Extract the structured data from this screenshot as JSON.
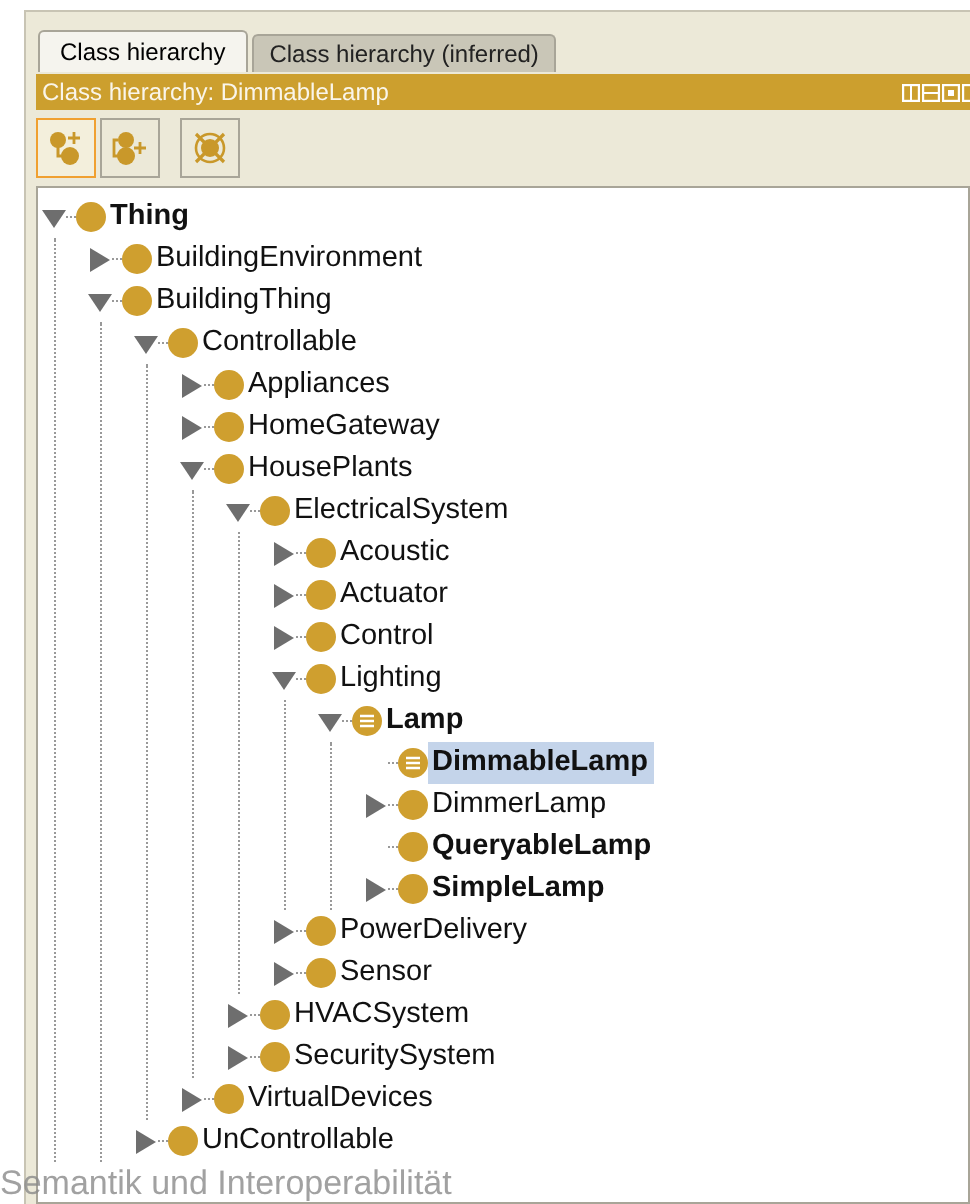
{
  "tabs": [
    {
      "label": "Class hierarchy",
      "selected": true
    },
    {
      "label": "Class hierarchy (inferred)",
      "selected": false
    }
  ],
  "view_title": "Class hierarchy: DimmableLamp",
  "toolbar": [
    {
      "kind": "add-subclass",
      "active": true
    },
    {
      "kind": "add-sibling",
      "active": false
    },
    {
      "kind": "delete",
      "active": false
    }
  ],
  "tree": [
    {
      "label": "Thing",
      "expanded": true,
      "bold": true,
      "kind": "primitive",
      "selected": false,
      "children": [
        {
          "label": "BuildingEnvironment",
          "expanded": false,
          "bold": false,
          "kind": "primitive",
          "selected": false
        },
        {
          "label": "BuildingThing",
          "expanded": true,
          "bold": false,
          "kind": "primitive",
          "selected": false,
          "children": [
            {
              "label": "Controllable",
              "expanded": true,
              "bold": false,
              "kind": "primitive",
              "selected": false,
              "children": [
                {
                  "label": "Appliances",
                  "expanded": false,
                  "bold": false,
                  "kind": "primitive",
                  "selected": false
                },
                {
                  "label": "HomeGateway",
                  "expanded": false,
                  "bold": false,
                  "kind": "primitive",
                  "selected": false
                },
                {
                  "label": "HousePlants",
                  "expanded": true,
                  "bold": false,
                  "kind": "primitive",
                  "selected": false,
                  "children": [
                    {
                      "label": "ElectricalSystem",
                      "expanded": true,
                      "bold": false,
                      "kind": "primitive",
                      "selected": false,
                      "children": [
                        {
                          "label": "Acoustic",
                          "expanded": false,
                          "bold": false,
                          "kind": "primitive",
                          "selected": false
                        },
                        {
                          "label": "Actuator",
                          "expanded": false,
                          "bold": false,
                          "kind": "primitive",
                          "selected": false
                        },
                        {
                          "label": "Control",
                          "expanded": false,
                          "bold": false,
                          "kind": "primitive",
                          "selected": false
                        },
                        {
                          "label": "Lighting",
                          "expanded": true,
                          "bold": false,
                          "kind": "primitive",
                          "selected": false,
                          "children": [
                            {
                              "label": "Lamp",
                              "expanded": true,
                              "bold": true,
                              "kind": "defined",
                              "selected": false,
                              "children": [
                                {
                                  "label": "DimmableLamp",
                                  "bold": true,
                                  "kind": "defined",
                                  "selected": true
                                },
                                {
                                  "label": "DimmerLamp",
                                  "expanded": false,
                                  "bold": false,
                                  "kind": "primitive",
                                  "selected": false
                                },
                                {
                                  "label": "QueryableLamp",
                                  "bold": true,
                                  "kind": "primitive",
                                  "selected": false
                                },
                                {
                                  "label": "SimpleLamp",
                                  "expanded": false,
                                  "bold": true,
                                  "kind": "primitive",
                                  "selected": false
                                }
                              ]
                            }
                          ]
                        },
                        {
                          "label": "PowerDelivery",
                          "expanded": false,
                          "bold": false,
                          "kind": "primitive",
                          "selected": false
                        },
                        {
                          "label": "Sensor",
                          "expanded": false,
                          "bold": false,
                          "kind": "primitive",
                          "selected": false
                        }
                      ]
                    },
                    {
                      "label": "HVACSystem",
                      "expanded": false,
                      "bold": false,
                      "kind": "primitive",
                      "selected": false
                    },
                    {
                      "label": "SecuritySystem",
                      "expanded": false,
                      "bold": false,
                      "kind": "primitive",
                      "selected": false
                    }
                  ]
                },
                {
                  "label": "VirtualDevices",
                  "expanded": false,
                  "bold": false,
                  "kind": "primitive",
                  "selected": false
                }
              ]
            },
            {
              "label": "UnControllable",
              "expanded": false,
              "bold": false,
              "kind": "primitive",
              "selected": false
            }
          ]
        }
      ]
    }
  ],
  "background_caption": "Semantik und Interoperabilität"
}
